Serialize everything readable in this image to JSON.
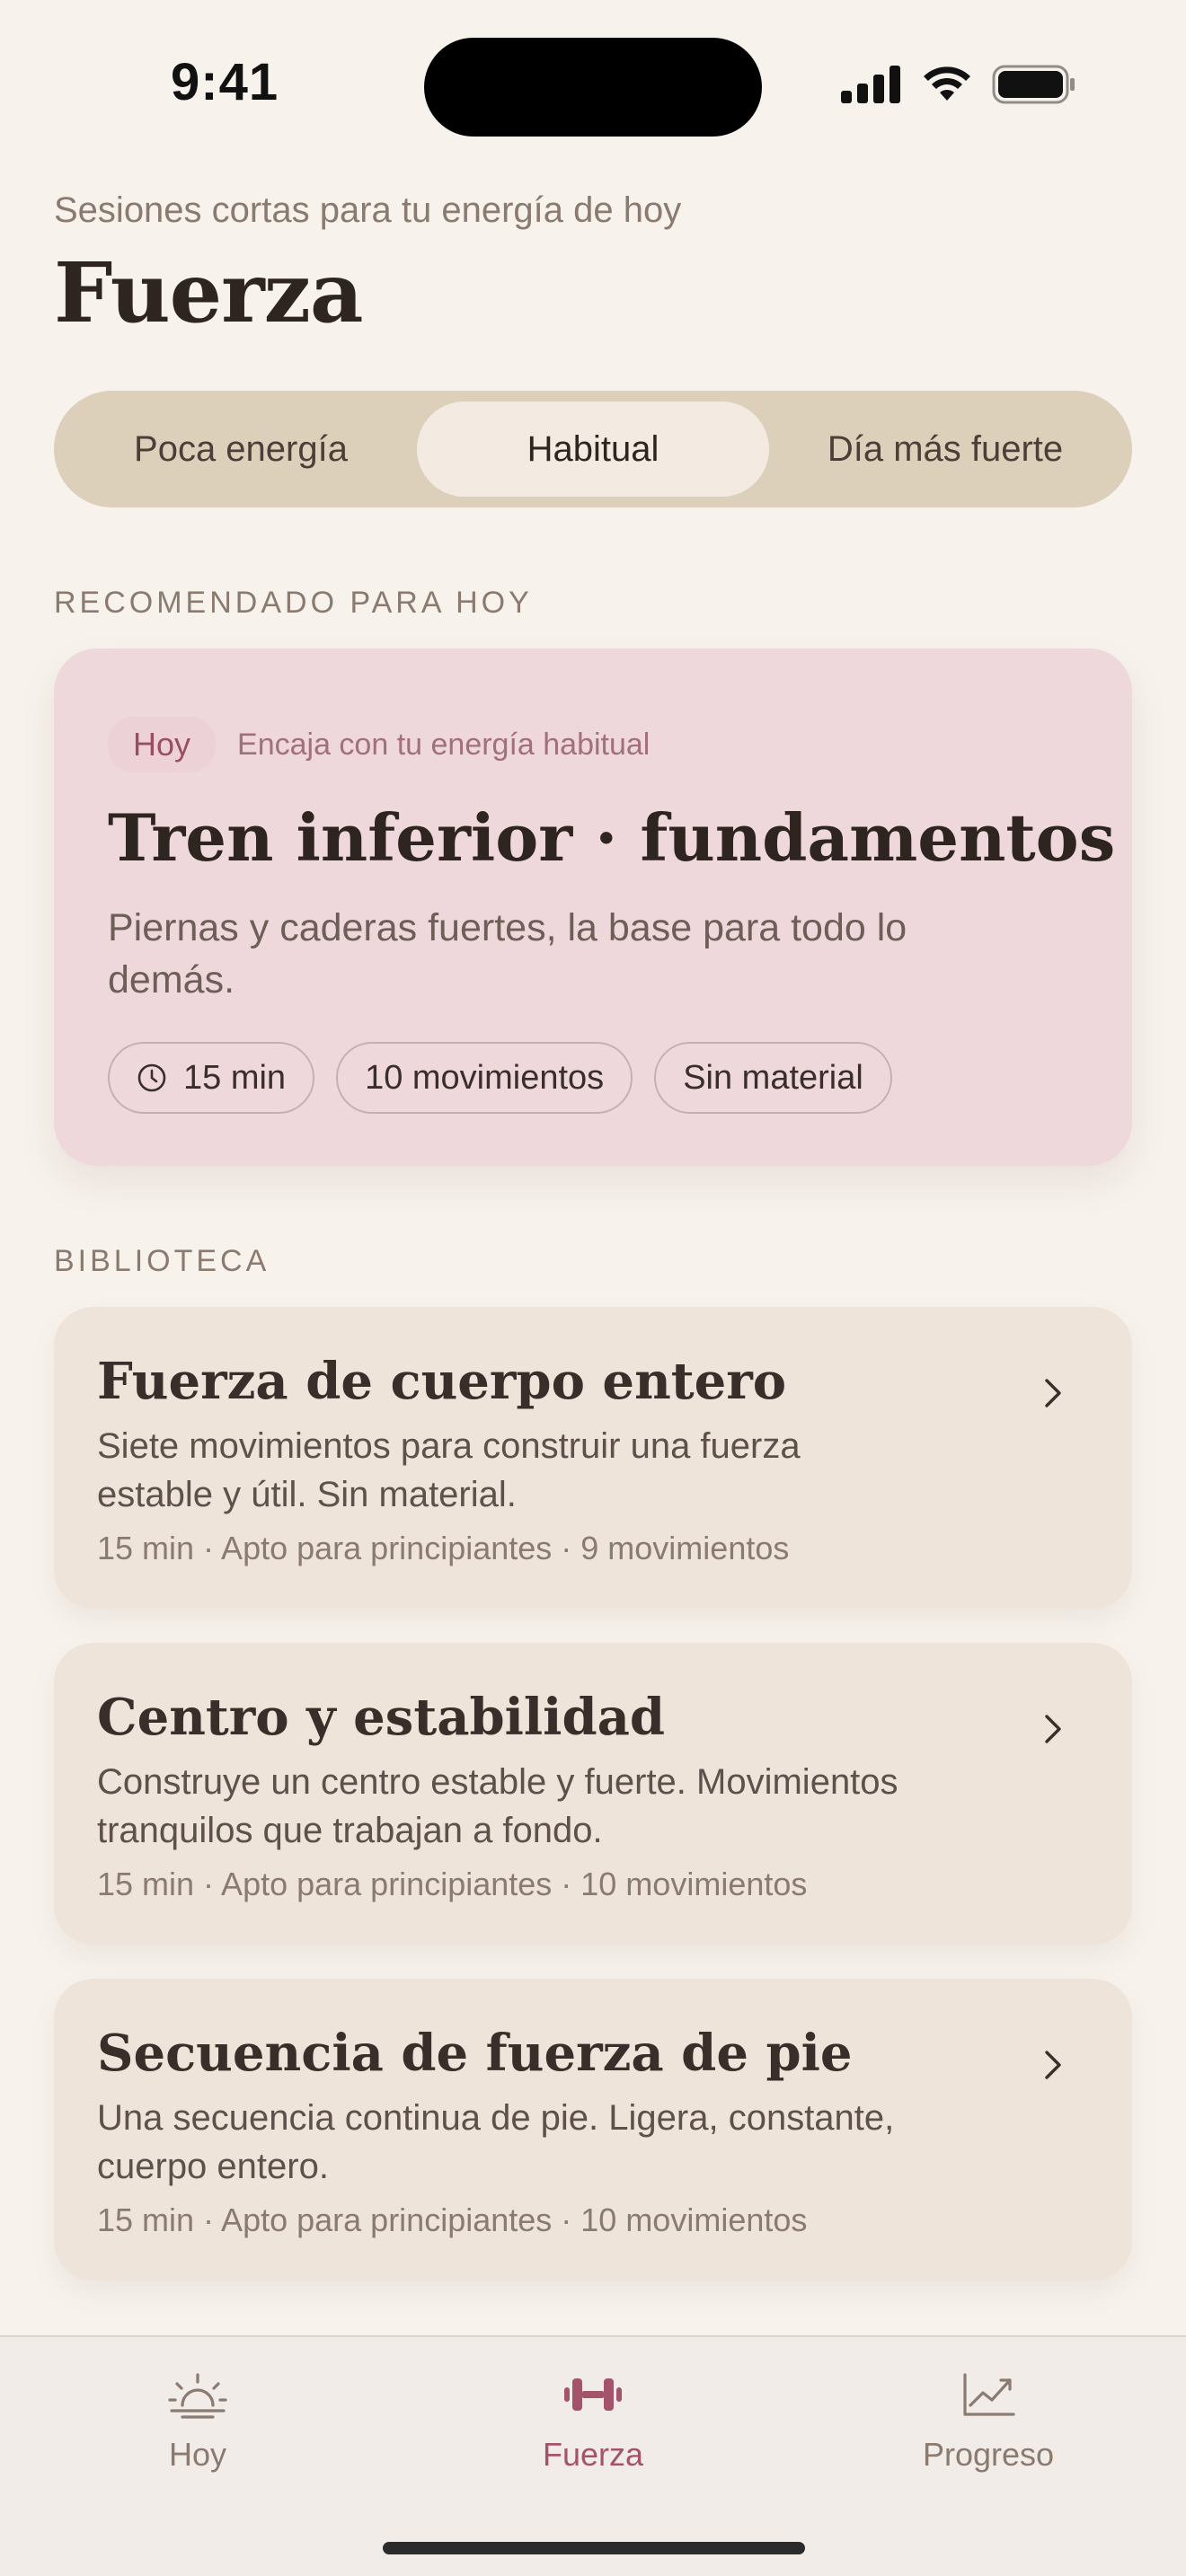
{
  "status_bar": {
    "time": "9:41"
  },
  "header": {
    "subtitle": "Sesiones cortas para tu energía de hoy",
    "title": "Fuerza"
  },
  "energy_filter": {
    "options": [
      "Poca energía",
      "Habitual",
      "Día más fuerte"
    ],
    "selected": "Habitual"
  },
  "recommended": {
    "section_label": "RECOMENDADO PARA HOY",
    "badge": "Hoy",
    "badge_note": "Encaja con tu energía habitual",
    "title": "Tren inferior · fundamentos",
    "description": "Piernas y caderas fuertes, la base para todo lo demás.",
    "chips": [
      "15 min",
      "10 movimientos",
      "Sin material"
    ]
  },
  "library": {
    "section_label": "BIBLIOTECA",
    "items": [
      {
        "title": "Fuerza de cuerpo entero",
        "description": "Siete movimientos para construir una fuerza estable y útil. Sin material.",
        "meta": "15 min · Apto para principiantes · 9 movimientos"
      },
      {
        "title": "Centro y estabilidad",
        "description": "Construye un centro estable y fuerte. Movimientos tranquilos que trabajan a fondo.",
        "meta": "15 min · Apto para principiantes · 10 movimientos"
      },
      {
        "title": "Secuencia de fuerza de pie",
        "description": "Una secuencia continua de pie. Ligera, constante, cuerpo entero.",
        "meta": "15 min · Apto para principiantes · 10 movimientos"
      }
    ]
  },
  "tab_bar": {
    "tabs": [
      {
        "label": "Hoy",
        "icon": "sunrise-icon"
      },
      {
        "label": "Fuerza",
        "icon": "dumbbell-icon"
      },
      {
        "label": "Progreso",
        "icon": "chart-trend-icon"
      }
    ],
    "active": "Fuerza"
  },
  "colors": {
    "background": "#f7f2ec",
    "accent": "#a3546c",
    "hero_card": "#eed8db",
    "segment_track": "#ddd0bb"
  }
}
